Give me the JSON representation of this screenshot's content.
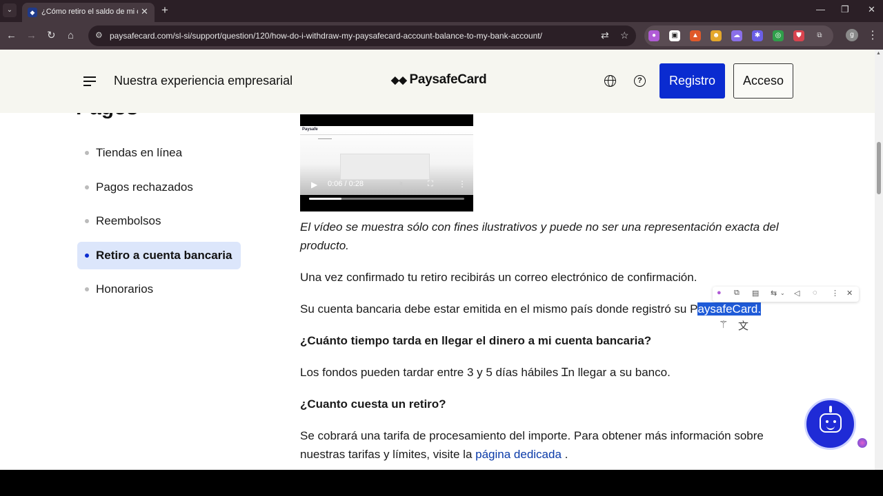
{
  "browser": {
    "tab": {
      "title": "¿Cómo retiro el saldo de mi cuenta",
      "close": "✕"
    },
    "new_tab": "+",
    "window": {
      "minimize": "—",
      "maximize": "❐",
      "close": "✕"
    },
    "nav": {
      "back": "←",
      "forward": "→",
      "reload": "↻",
      "home": "⌂"
    },
    "url": "paysafecard.com/sl-si/support/question/120/how-do-i-withdraw-my-paysafecard-account-balance-to-my-bank-account/",
    "profile_initial": "g",
    "extensions": [
      "brain-extension-icon",
      "copy-extension-icon",
      "fox-extension-icon",
      "person-extension-icon",
      "cloud-extension-icon",
      "gear-extension-icon",
      "chrome-extension-icon",
      "shield-extension-icon",
      "puzzle-icon"
    ]
  },
  "header": {
    "business_link": "Nuestra experiencia empresarial",
    "logo": "PaysafeCard",
    "register": "Registro",
    "login": "Acceso"
  },
  "sidebar": {
    "heading": "Pagos",
    "items": [
      {
        "label": "Tiendas en línea",
        "active": false
      },
      {
        "label": "Pagos rechazados",
        "active": false
      },
      {
        "label": "Reembolsos",
        "active": false
      },
      {
        "label": "Retiro a cuenta bancaria",
        "active": true
      },
      {
        "label": "Honorarios",
        "active": false
      }
    ]
  },
  "video": {
    "brand": "Paysafe",
    "time": "0:06 / 0:28",
    "progress": 0.21
  },
  "article": {
    "caption": "El vídeo se muestra sólo con fines ilustrativos y puede no ser una representación exacta del producto.",
    "p1": "Una vez confirmado tu retiro recibirás un correo electrónico de confirmación.",
    "p2_before": "Su cuenta bancaria debe estar emitida en el mismo país donde registró su P",
    "p2_selected": "aysafeCard.",
    "h1": "¿Cuánto tiempo tarda en llegar el dinero a mi cuenta bancaria?",
    "p3_before": "Los fondos pueden tardar entre 3 y 5 días hábiles ",
    "p3_after": "n llegar a su banco.",
    "h2": "¿Cuanto cuesta un retiro?",
    "p4_line1": "Se cobrará una tarifa de procesamiento del importe. Para obtener más información sobre",
    "p4_line2_before": "nuestras tarifas y límites, visite la ",
    "p4_link": "página dedicada",
    "p4_after": " ."
  },
  "colors": {
    "brand_blue": "#0a2bd0",
    "active_bg": "#dce6fb",
    "header_bg": "#f6f6f0",
    "selection": "#1f5bd8",
    "link": "#0a3aa8"
  }
}
